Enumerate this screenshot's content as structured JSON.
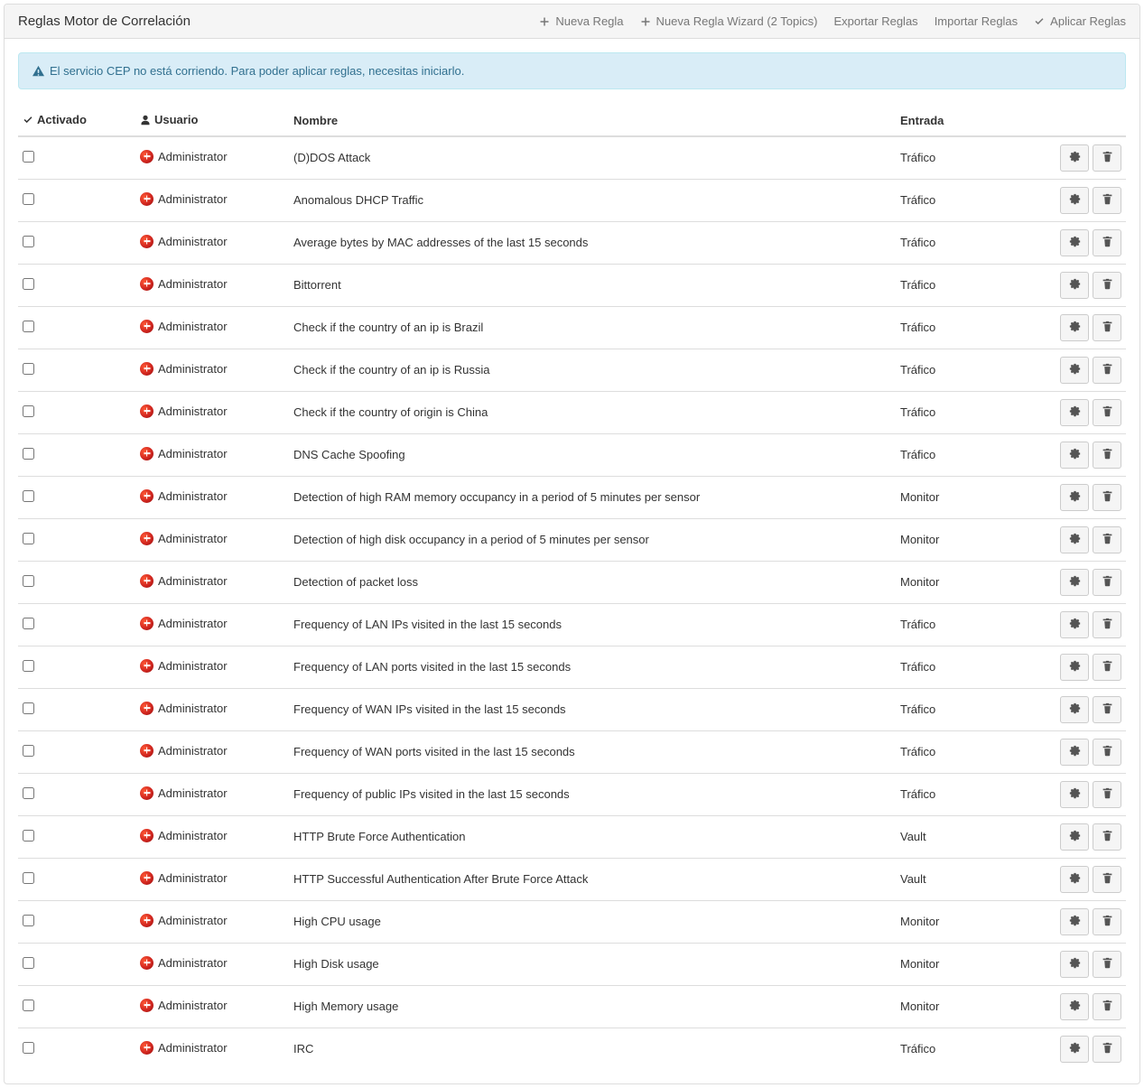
{
  "header": {
    "title": "Reglas Motor de Correlación",
    "actions": {
      "new_rule": "Nueva Regla",
      "new_rule_wizard": "Nueva Regla Wizard (2 Topics)",
      "export_rules": "Exportar Reglas",
      "import_rules": "Importar Reglas",
      "apply_rules": "Aplicar Reglas"
    }
  },
  "alert": {
    "text": "El servicio CEP no está corriendo. Para poder aplicar reglas, necesitas iniciarlo."
  },
  "table": {
    "columns": {
      "enabled": "Activado",
      "user": "Usuario",
      "name": "Nombre",
      "entry": "Entrada"
    },
    "rows": [
      {
        "user": "Administrator",
        "name": "(D)DOS Attack",
        "entry": "Tráfico"
      },
      {
        "user": "Administrator",
        "name": "Anomalous DHCP Traffic",
        "entry": "Tráfico"
      },
      {
        "user": "Administrator",
        "name": "Average bytes by MAC addresses of the last 15 seconds",
        "entry": "Tráfico"
      },
      {
        "user": "Administrator",
        "name": "Bittorrent",
        "entry": "Tráfico"
      },
      {
        "user": "Administrator",
        "name": "Check if the country of an ip is Brazil",
        "entry": "Tráfico"
      },
      {
        "user": "Administrator",
        "name": "Check if the country of an ip is Russia",
        "entry": "Tráfico"
      },
      {
        "user": "Administrator",
        "name": "Check if the country of origin is China",
        "entry": "Tráfico"
      },
      {
        "user": "Administrator",
        "name": "DNS Cache Spoofing",
        "entry": "Tráfico"
      },
      {
        "user": "Administrator",
        "name": "Detection of high RAM memory occupancy in a period of 5 minutes per sensor",
        "entry": "Monitor"
      },
      {
        "user": "Administrator",
        "name": "Detection of high disk occupancy in a period of 5 minutes per sensor",
        "entry": "Monitor"
      },
      {
        "user": "Administrator",
        "name": "Detection of packet loss",
        "entry": "Monitor"
      },
      {
        "user": "Administrator",
        "name": "Frequency of LAN IPs visited in the last 15 seconds",
        "entry": "Tráfico"
      },
      {
        "user": "Administrator",
        "name": "Frequency of LAN ports visited in the last 15 seconds",
        "entry": "Tráfico"
      },
      {
        "user": "Administrator",
        "name": "Frequency of WAN IPs visited in the last 15 seconds",
        "entry": "Tráfico"
      },
      {
        "user": "Administrator",
        "name": "Frequency of WAN ports visited in the last 15 seconds",
        "entry": "Tráfico"
      },
      {
        "user": "Administrator",
        "name": "Frequency of public IPs visited in the last 15 seconds",
        "entry": "Tráfico"
      },
      {
        "user": "Administrator",
        "name": "HTTP Brute Force Authentication",
        "entry": "Vault"
      },
      {
        "user": "Administrator",
        "name": "HTTP Successful Authentication After Brute Force Attack",
        "entry": "Vault"
      },
      {
        "user": "Administrator",
        "name": "High CPU usage",
        "entry": "Monitor"
      },
      {
        "user": "Administrator",
        "name": "High Disk usage",
        "entry": "Monitor"
      },
      {
        "user": "Administrator",
        "name": "High Memory usage",
        "entry": "Monitor"
      },
      {
        "user": "Administrator",
        "name": "IRC",
        "entry": "Tráfico"
      }
    ]
  }
}
